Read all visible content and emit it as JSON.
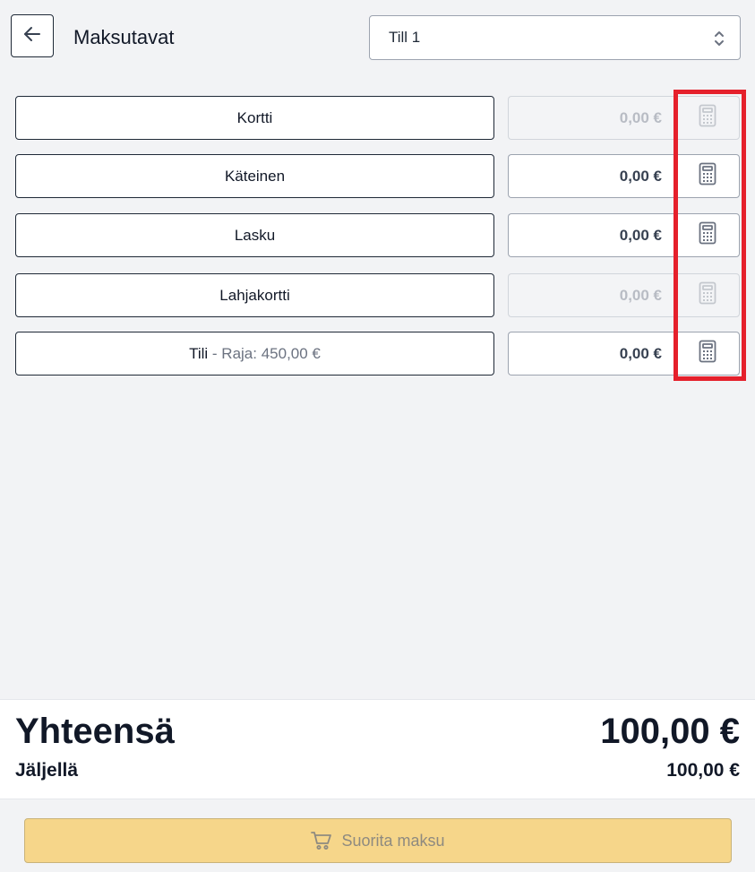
{
  "header": {
    "title": "Maksutavat",
    "till_select": {
      "value": "Till 1"
    }
  },
  "payment_methods": [
    {
      "label": "Kortti",
      "sublabel": "",
      "amount": "0,00 €",
      "enabled": false
    },
    {
      "label": "Käteinen",
      "sublabel": "",
      "amount": "0,00 €",
      "enabled": true
    },
    {
      "label": "Lasku",
      "sublabel": "",
      "amount": "0,00 €",
      "enabled": true
    },
    {
      "label": "Lahjakortti",
      "sublabel": "",
      "amount": "0,00 €",
      "enabled": false
    },
    {
      "label": "Tili",
      "sublabel": " - Raja: 450,00 €",
      "amount": "0,00 €",
      "enabled": true
    }
  ],
  "totals": {
    "total_label": "Yhteensä",
    "total_value": "100,00 €",
    "remaining_label": "Jäljellä",
    "remaining_value": "100,00 €"
  },
  "pay_button": {
    "label": "Suorita maksu",
    "icon": "cart-icon"
  },
  "icons": {
    "back": "arrow-left-icon",
    "select": "chevron-up-down-icon",
    "calculator": "calculator-icon"
  },
  "colors": {
    "highlight": "#e5202b",
    "pay_button": "#f6d68a",
    "background": "#f2f3f5"
  }
}
